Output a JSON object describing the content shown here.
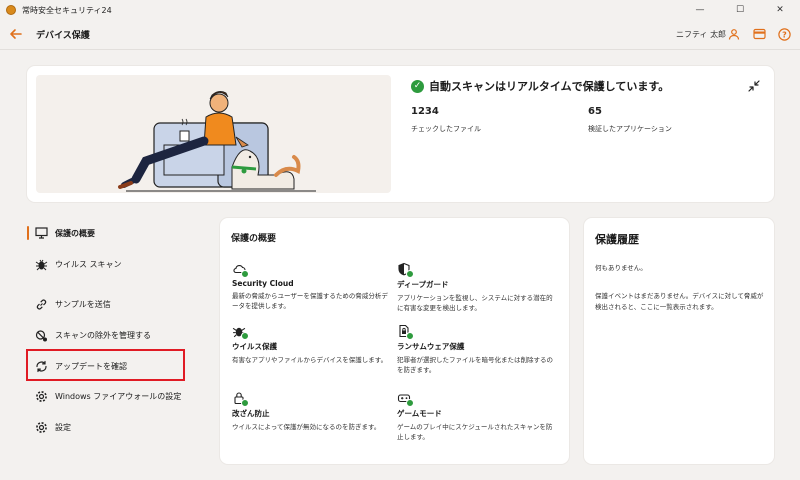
{
  "window": {
    "title": "常時安全セキュリティ24",
    "controls": [
      "—",
      "☐",
      "✕"
    ]
  },
  "header": {
    "back_icon": "arrow-left-icon",
    "title": "デバイス保護",
    "user_name": "ニフティ 太郎",
    "icons": [
      "user-icon",
      "card-icon",
      "help-icon"
    ],
    "help_glyph": "?",
    "accent_color": "#e0701b"
  },
  "hero": {
    "status_text": "自動スキャンはリアルタイムで保護しています。",
    "status_color": "#2e9b3e",
    "stats": [
      {
        "value": "1234",
        "label": "チェックしたファイル"
      },
      {
        "value": "65",
        "label": "検証したアプリケーション"
      }
    ]
  },
  "sidebar": {
    "items": [
      {
        "label": "保護の概要",
        "icon": "monitor-icon",
        "active": true
      },
      {
        "label": "ウイルス スキャン",
        "icon": "bug-icon",
        "active": false
      },
      {
        "label": "サンプルを送信",
        "icon": "link-icon",
        "active": false
      },
      {
        "label": "スキャンの除外を管理する",
        "icon": "exclude-icon",
        "active": false
      },
      {
        "label": "アップデートを確認",
        "icon": "refresh-icon",
        "active": false
      },
      {
        "label": "Windows ファイアウォールの設定",
        "icon": "gear-icon",
        "active": false
      },
      {
        "label": "設定",
        "icon": "gear-icon",
        "active": false
      }
    ]
  },
  "overview": {
    "title": "保護の概要",
    "features": [
      {
        "name": "Security Cloud",
        "desc": "最新の脅威からユーザーを保護するための脅威分析データを提供します。",
        "icon": "cloud-icon"
      },
      {
        "name": "ディープガード",
        "desc": "アプリケーションを監視し、システムに対する潜在的に有害な変更を検出します。",
        "icon": "shield-icon"
      },
      {
        "name": "ウイルス保護",
        "desc": "有害なアプリやファイルからデバイスを保護します。",
        "icon": "bug-icon"
      },
      {
        "name": "ランサムウェア保護",
        "desc": "犯罪者が選択したファイルを暗号化または削除するのを防ぎます。",
        "icon": "document-lock-icon"
      },
      {
        "name": "改ざん防止",
        "desc": "ウイルスによって保護が無効になるのを防ぎます。",
        "icon": "lock-icon"
      },
      {
        "name": "ゲームモード",
        "desc": "ゲームのプレイ中にスケジュールされたスキャンを防止します。",
        "icon": "gamepad-icon"
      }
    ]
  },
  "history": {
    "title": "保護履歴",
    "empty_text": "何もありません。",
    "description": "保護イベントはまだありません。デバイスに対して脅威が検出されると、ここに一覧表示されます。"
  }
}
